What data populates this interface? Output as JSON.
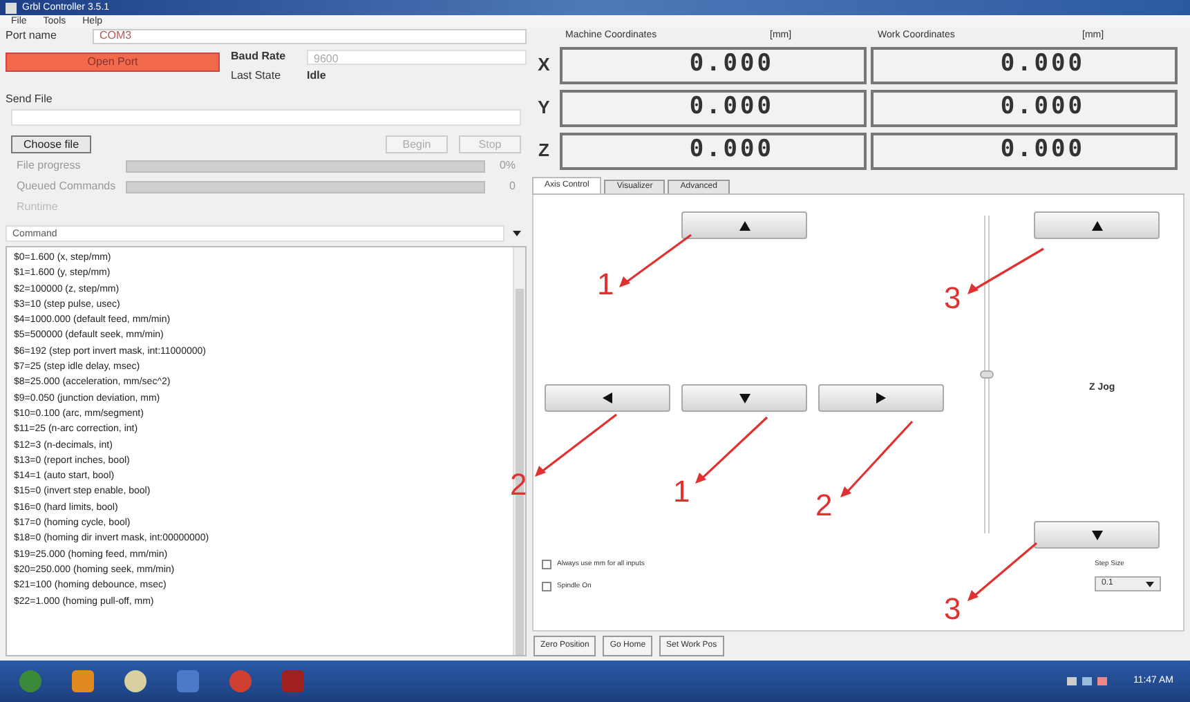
{
  "window": {
    "title": "Grbl Controller 3.5.1"
  },
  "menu": [
    "File",
    "Tools",
    "Help"
  ],
  "port": {
    "label": "Port name",
    "value": "COM3"
  },
  "open_button": "Open Port",
  "baud": {
    "label": "Baud Rate",
    "value": "9600"
  },
  "last_state": {
    "label": "Last State",
    "value": "Idle"
  },
  "send_file": {
    "label": "Send File"
  },
  "file_buttons": [
    "Choose file",
    "Begin",
    "Stop"
  ],
  "progress": [
    {
      "label": "File progress",
      "level": 0,
      "reading": "0%"
    },
    {
      "label": "Queued Commands",
      "level": 0,
      "reading": "0"
    }
  ],
  "runtime": {
    "label": "Runtime"
  },
  "command": {
    "placeholder": "Command"
  },
  "output_lines": [
    "$0=1.600 (x, step/mm)",
    "$1=1.600 (y, step/mm)",
    "$2=100000 (z, step/mm)",
    "$3=10 (step pulse, usec)",
    "$4=1000.000 (default feed, mm/min)",
    "$5=500000 (default seek, mm/min)",
    "$6=192 (step port invert mask, int:11000000)",
    "$7=25 (step idle delay, msec)",
    "$8=25.000 (acceleration, mm/sec^2)",
    "$9=0.050 (junction deviation, mm)",
    "$10=0.100 (arc, mm/segment)",
    "$11=25 (n-arc correction, int)",
    "$12=3 (n-decimals, int)",
    "$13=0 (report inches, bool)",
    "$14=1 (auto start, bool)",
    "$15=0 (invert step enable, bool)",
    "$16=0 (hard limits, bool)",
    "$17=0 (homing cycle, bool)",
    "$18=0 (homing dir invert mask, int:00000000)",
    "$19=25.000 (homing feed, mm/min)",
    "$20=250.000 (homing seek, mm/min)",
    "$21=100 (homing debounce, msec)",
    "$22=1.000 (homing pull-off, mm)"
  ],
  "coordinates": {
    "machine_title": "Machine Coordinates",
    "work_title": "Work Coordinates",
    "machine_unit": "[mm]",
    "work_unit": "[mm]",
    "rows": [
      {
        "axis": "X",
        "machine": "0.000",
        "work": "0.000"
      },
      {
        "axis": "Y",
        "machine": "0.000",
        "work": "0.000"
      },
      {
        "axis": "Z",
        "machine": "0.000",
        "work": "0.000"
      }
    ]
  },
  "tabs": [
    {
      "label": "Axis Control",
      "selected": true
    },
    {
      "label": "Visualizer",
      "selected": false
    },
    {
      "label": "Advanced",
      "selected": false
    }
  ],
  "z_jog": {
    "label": "Z Jog",
    "level": 0.5
  },
  "checkboxes": [
    {
      "label": "Always use mm for all inputs",
      "checked": false
    },
    {
      "label": "Spindle On",
      "checked": false
    }
  ],
  "step_size": {
    "label": "Step Size",
    "value": "0.1"
  },
  "bottom_buttons": [
    "Zero Position",
    "Go Home",
    "Set Work Pos"
  ],
  "annotations": [
    {
      "label": "1"
    },
    {
      "label": "3"
    },
    {
      "label": "2"
    },
    {
      "label": "1"
    },
    {
      "label": "2"
    },
    {
      "label": "3"
    }
  ],
  "taskbar": {
    "time": "11:47 AM"
  }
}
